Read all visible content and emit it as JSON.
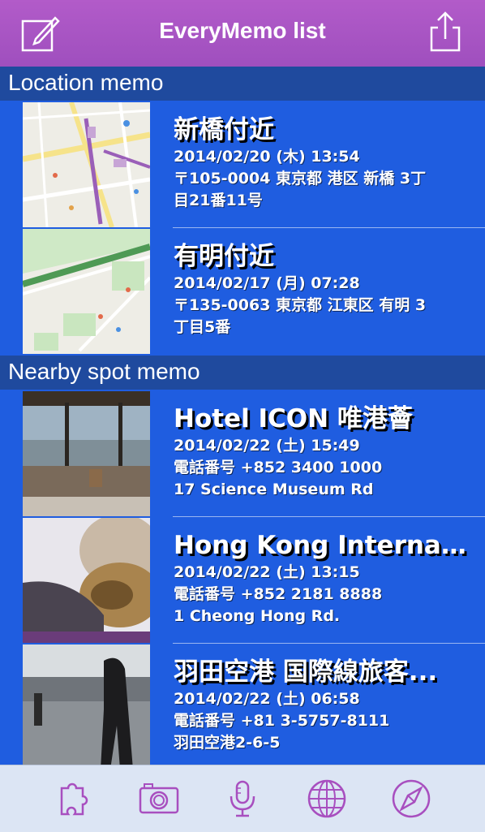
{
  "nav": {
    "title": "EveryMemo list",
    "left_icon": "compose-icon",
    "right_icon": "share-icon"
  },
  "sections": [
    {
      "title": "Location memo",
      "items": [
        {
          "title": "新橋付近",
          "line1": "2014/02/20 (木) 13:54",
          "line2": "〒105-0004 東京都 港区 新橋 3丁",
          "line3": "目21番11号",
          "thumb": "map-thumbnail"
        },
        {
          "title": "有明付近",
          "line1": "2014/02/17 (月) 07:28",
          "line2": "〒135-0063 東京都 江東区 有明 3",
          "line3": "丁目5番",
          "thumb": "map-thumbnail"
        }
      ]
    },
    {
      "title": "Nearby spot memo",
      "items": [
        {
          "title": "Hotel ICON 唯港薈",
          "line1": "2014/02/22 (土) 15:49",
          "line2": "電話番号 +852 3400 1000",
          "line3": "17 Science Museum Rd",
          "thumb": "photo-thumbnail"
        },
        {
          "title": "Hong Kong Internati...",
          "line1": "2014/02/22 (土) 13:15",
          "line2": "電話番号 +852 2181 8888",
          "line3": "1 Cheong Hong Rd.",
          "thumb": "photo-thumbnail"
        },
        {
          "title": "羽田空港 国際線旅客...",
          "line1": "2014/02/22 (土) 06:58",
          "line2": "電話番号 +81 3-5757-8111",
          "line3": "羽田空港2-6-5",
          "thumb": "photo-thumbnail"
        }
      ]
    }
  ],
  "tabbar": {
    "icons": [
      "puzzle-icon",
      "camera-icon",
      "microphone-icon",
      "globe-icon",
      "compass-icon"
    ]
  },
  "colors": {
    "nav": "#a954c4",
    "list_background": "#1f5de0",
    "section_header": "#1f4a9e",
    "tab_icon": "#a84fbf"
  }
}
